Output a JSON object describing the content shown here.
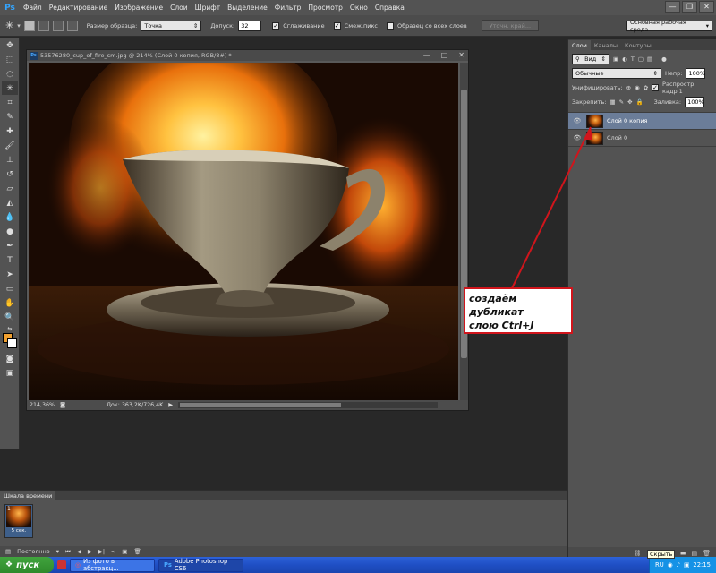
{
  "app": {
    "logo": "Ps"
  },
  "menu": [
    "Файл",
    "Редактирование",
    "Изображение",
    "Слои",
    "Шрифт",
    "Выделение",
    "Фильтр",
    "Просмотр",
    "Окно",
    "Справка"
  ],
  "window_controls": {
    "minimize": "—",
    "restore": "❐",
    "close": "✕"
  },
  "options_bar": {
    "sample_size_label": "Размер образца:",
    "sample_size_value": "Точка",
    "tolerance_label": "Допуск:",
    "tolerance_value": "32",
    "antialias_label": "Сглаживание",
    "antialias_checked": true,
    "contiguous_label": "Смеж.пикс",
    "contiguous_checked": true,
    "sample_all_label": "Образец со всех слоев",
    "sample_all_checked": false,
    "refine_edge_label": "Уточн. край...",
    "workspace_value": "Основная рабочая среда"
  },
  "document": {
    "title": "53576280_cup_of_fire_sm.jpg @ 214% (Слой 0 копия, RGB/8#) *",
    "zoom": "214,36%",
    "doc_info": "Док: 363,2K/726,4K"
  },
  "layers_panel": {
    "tabs": [
      "Слои",
      "Каналы",
      "Контуры"
    ],
    "active_tab": 0,
    "filter_kind": "Вид",
    "blend_mode": "Обычные",
    "opacity_label": "Непр:",
    "opacity_value": "100%",
    "unify_label": "Унифицировать:",
    "propagate_label": "Распростр. кадр 1",
    "lock_label": "Закрепить:",
    "fill_label": "Заливка:",
    "fill_value": "100%",
    "layers": [
      {
        "name": "Слой 0 копия",
        "selected": true
      },
      {
        "name": "Слой 0",
        "selected": false
      }
    ]
  },
  "timeline": {
    "title": "Шкала времени",
    "frame_number": "1",
    "frame_delay": "5 сек.",
    "loop_mode": "Постоянно"
  },
  "annotation": {
    "line1": "создаём дубликат",
    "line2": "слою  Ctrl+J",
    "color": "#d0151c"
  },
  "taskbar": {
    "start_label": "пуск",
    "tasks": [
      "Из фото в абстракц...",
      "Adobe Photoshop CS6"
    ],
    "lang": "RU",
    "clock": "22:15",
    "tooltip": "Скрыть"
  }
}
